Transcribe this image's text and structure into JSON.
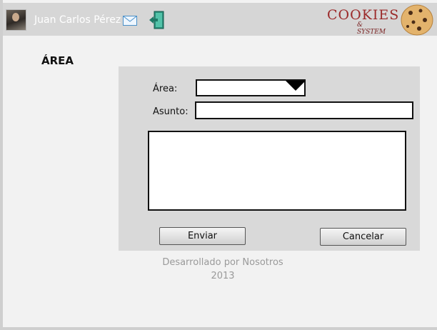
{
  "header": {
    "user_name": "Juan Carlos Pérez",
    "brand_name": "COOKIES",
    "brand_tagline": "& SYSTEM"
  },
  "page": {
    "section_title": "ÁREA"
  },
  "form": {
    "area_label": "Área:",
    "area_value": "",
    "subject_label": "Asunto:",
    "subject_value": "",
    "message_value": "",
    "submit_label": "Enviar",
    "cancel_label": "Cancelar"
  },
  "footer": {
    "line1": "Desarrollado por Nosotros",
    "line2": "2013"
  },
  "colors": {
    "header_bg": "#d6d6d6",
    "page_bg": "#f2f2f2",
    "panel_bg": "#d9d9d9",
    "brand_red": "#9b2a2a"
  },
  "icons": [
    "avatar",
    "mail-icon",
    "exit-icon",
    "cookie-logo-icon",
    "dropdown-arrow-icon"
  ]
}
